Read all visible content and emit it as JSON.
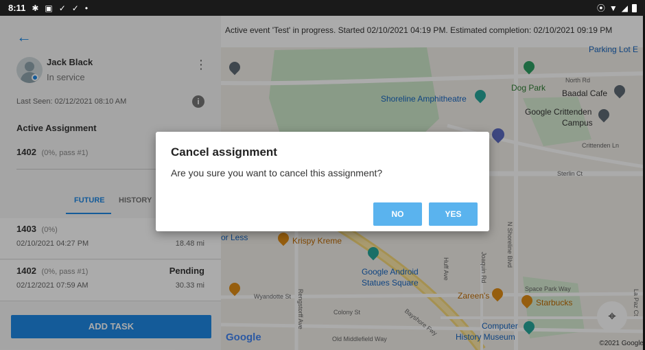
{
  "status_bar": {
    "time": "8:11",
    "left_icons": [
      "settings-icon",
      "image-icon",
      "check-icon",
      "check-icon",
      "dot-icon"
    ],
    "right_icons": [
      "location-icon",
      "wifi-icon",
      "signal-icon",
      "battery-icon"
    ]
  },
  "driver_panel": {
    "back_icon": "arrow-left-icon",
    "driver_name": "Jack Black",
    "driver_status": "In service",
    "last_seen": "Last Seen: 02/12/2021 08:10 AM",
    "active_assignment_heading": "Active Assignment",
    "active_assignment": {
      "id": "1402",
      "detail": "(0%, pass #1)"
    },
    "tabs": [
      {
        "label": "FUTURE",
        "selected": true
      },
      {
        "label": "HISTORY",
        "selected": false
      }
    ],
    "tasks": [
      {
        "id": "1403",
        "detail": "(0%)",
        "date": "02/10/2021 04:27 PM",
        "status": "",
        "distance": "18.48 mi"
      },
      {
        "id": "1402",
        "detail": "(0%, pass #1)",
        "date": "02/12/2021 07:59 AM",
        "status": "Pending",
        "distance": "30.33 mi"
      }
    ],
    "add_task_label": "ADD TASK"
  },
  "map": {
    "event_banner": "Active event 'Test' in progress. Started 02/10/2021 04:19 PM. Estimated completion: 02/10/2021 09:19 PM",
    "labels": {
      "parking": "Parking Lot E",
      "north_rd": "North Rd",
      "dog_park": "Dog Park",
      "baadal": "Baadal Cafe",
      "shoreline": "Shoreline Amphitheatre",
      "crittenden_campus_1": "Google Crittenden",
      "crittenden_campus_2": "Campus",
      "crittenden_ln": "Crittenden Ln",
      "sterlin": "Sterlin Ct",
      "shoreline_blvd": "N Shoreline Blvd",
      "or_less": "or Less",
      "krispy": "Krispy Kreme",
      "android_1": "Google Android",
      "android_2": "Statues Square",
      "huff": "Huff Ave",
      "joaquin": "Joaquin Rd",
      "space_park": "Space Park Way",
      "zareens": "Zareen's",
      "starbucks": "Starbucks",
      "wyandotte": "Wyandotte St",
      "colony": "Colony St",
      "rengstorff": "Rengstorff Ave",
      "bayshore": "Bayshore Fwy",
      "old_middlefield": "Old Middlefield Way",
      "museum_1": "Computer",
      "museum_2": "History Museum",
      "la_paz": "La Paz Ct"
    },
    "google_logo": "Google",
    "copyright": "©2021 Google",
    "locate_icon": "my-location-icon"
  },
  "dialog": {
    "title": "Cancel assignment",
    "message": "Are you sure you want to cancel this assignment?",
    "no_label": "NO",
    "yes_label": "YES"
  },
  "colors": {
    "accent": "#1e88e5",
    "dialog_button": "#5ab3ee"
  }
}
